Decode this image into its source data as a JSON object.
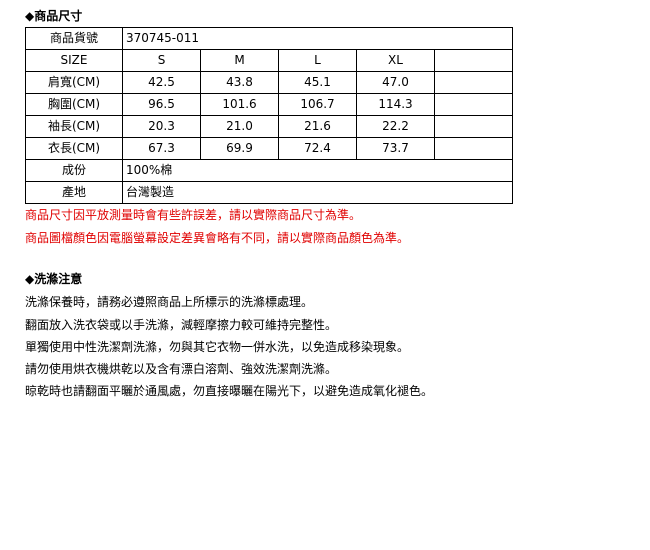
{
  "size_section": {
    "title": "◆商品尺寸",
    "product_code_label": "商品貨號",
    "product_code": "370745-011",
    "size_header": "SIZE",
    "sizes": [
      "S",
      "M",
      "L",
      "XL"
    ],
    "rows": [
      {
        "label": "肩寬(CM)",
        "values": [
          "42.5",
          "43.8",
          "45.1",
          "47.0"
        ]
      },
      {
        "label": "胸圍(CM)",
        "values": [
          "96.5",
          "101.6",
          "106.7",
          "114.3"
        ]
      },
      {
        "label": "袖長(CM)",
        "values": [
          "20.3",
          "21.0",
          "21.6",
          "22.2"
        ]
      },
      {
        "label": "衣長(CM)",
        "values": [
          "67.3",
          "69.9",
          "72.4",
          "73.7"
        ]
      }
    ],
    "material_label": "成份",
    "material": "100%棉",
    "origin_label": "產地",
    "origin": "台灣製造",
    "notes": [
      "商品尺寸因平放測量時會有些許誤差，請以實際商品尺寸為準。",
      "商品圖檔顏色因電腦螢幕設定差異會略有不同，請以實際商品顏色為準。"
    ],
    "note_color": "#e00000"
  },
  "wash_section": {
    "title": "◆洗滌注意",
    "lines": [
      "洗滌保養時，請務必遵照商品上所標示的洗滌標處理。",
      "翻面放入洗衣袋或以手洗滌，減輕摩擦力較可維持完整性。",
      "單獨使用中性洗潔劑洗滌，勿與其它衣物一併水洗，以免造成移染現象。",
      "請勿使用烘衣機烘乾以及含有漂白溶劑、強效洗潔劑洗滌。",
      "晾乾時也請翻面平曬於通風處，勿直接曝曬在陽光下，以避免造成氧化褪色。"
    ]
  }
}
